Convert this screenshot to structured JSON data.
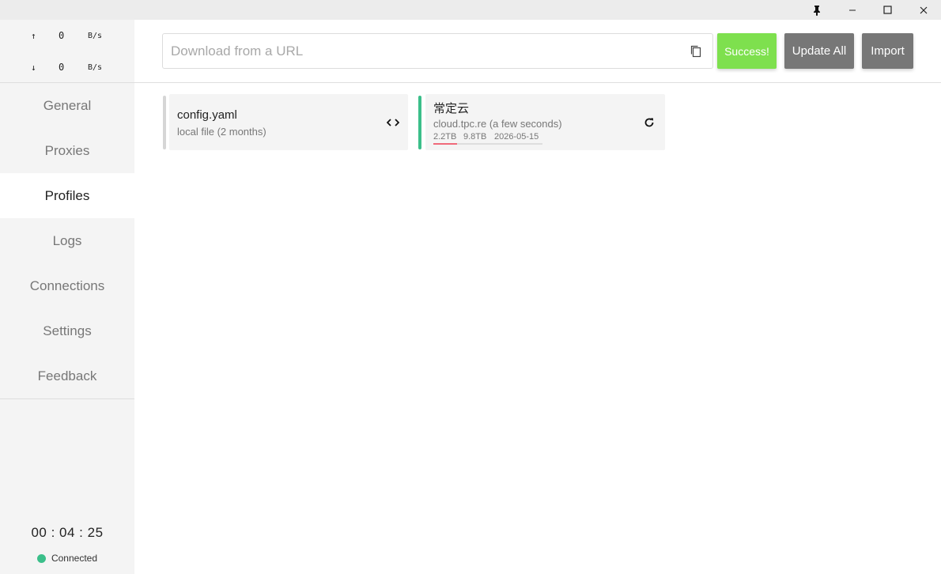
{
  "window": {
    "controls": {
      "pin": "pin-icon",
      "minimize": "–",
      "maximize": "▢",
      "close": "✕"
    }
  },
  "traffic": {
    "up": {
      "arrow": "↑",
      "value": "0",
      "unit": "B/s"
    },
    "down": {
      "arrow": "↓",
      "value": "0",
      "unit": "B/s"
    }
  },
  "sidebar": {
    "items": [
      {
        "label": "General"
      },
      {
        "label": "Proxies"
      },
      {
        "label": "Profiles"
      },
      {
        "label": "Logs"
      },
      {
        "label": "Connections"
      },
      {
        "label": "Settings"
      },
      {
        "label": "Feedback"
      }
    ],
    "active": "Profiles",
    "timer": "00 : 04 : 25",
    "status": {
      "label": "Connected",
      "color": "#3bbf8a"
    }
  },
  "toolbar": {
    "url_placeholder": "Download from a URL",
    "url_value": "",
    "success_label": "Success!",
    "update_all_label": "Update All",
    "import_label": "Import"
  },
  "profiles": [
    {
      "name": "config.yaml",
      "subtitle": "local file (2 months)",
      "action_icon": "code-icon",
      "selected": false,
      "bar_color": "#d6d6d6"
    },
    {
      "name": "常定云",
      "subtitle": "cloud.tpc.re (a few seconds)",
      "used": "2.2TB",
      "total": "9.8TB",
      "expire": "2026-05-15",
      "usage_fraction": 0.22,
      "action_icon": "refresh-icon",
      "selected": true,
      "bar_color": "#3bbf8a"
    }
  ],
  "colors": {
    "success": "#7ee04e",
    "button_gray": "#777777",
    "accent_green": "#3bbf8a",
    "usage_red": "#f06a7a"
  }
}
